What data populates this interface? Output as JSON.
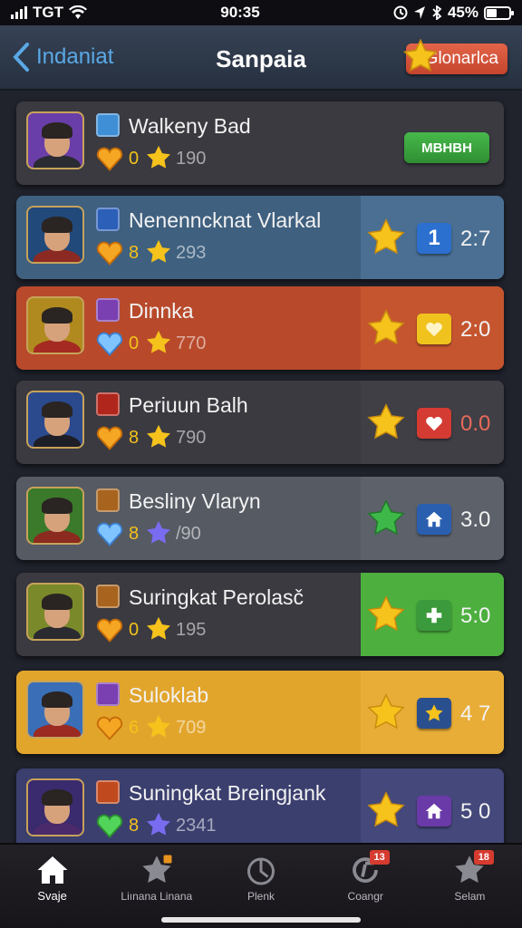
{
  "status_bar": {
    "carrier": "TGT",
    "time": "90:35",
    "battery_level": "45%",
    "battery_fraction": 0.45
  },
  "header": {
    "back_label": "Indaniat",
    "title": "Sanpaia",
    "button_label": "Glonarlca"
  },
  "rows": [
    {
      "name": "Walkeny Bad",
      "stat1": "0",
      "stat2": "190",
      "action_label": "MBHBH",
      "theme": "#3a3a40",
      "accent": "#3a3a40",
      "tag_color": "#3f8fd6",
      "gem": "gold",
      "avatar_bg": "#6a3ea8",
      "body": "#2b2b33"
    },
    {
      "name": "Nenenncknat Vlarkal",
      "stat1": "8",
      "stat2": "293",
      "badge_icon": "number-one-icon",
      "badge_text": "1",
      "badge_color": "#2b6fcf",
      "score": "2:7",
      "theme": "#3f607f",
      "accent": "#4a6f92",
      "tag_color": "#2c5fb8",
      "gem": "gold",
      "avatar_bg": "#21497a",
      "body": "#8b2a22"
    },
    {
      "name": "Dinnka",
      "stat1": "0",
      "stat2": "770",
      "badge_icon": "heart-icon",
      "badge_color": "#f0c21e",
      "score": "2:0",
      "theme": "#b84a2b",
      "accent": "#c5552f",
      "tag_color": "#7a3fb0",
      "gem": "blue",
      "avatar_bg": "#b08a1e",
      "body": "#a42a22"
    },
    {
      "name": "Periuun Balh",
      "stat1": "8",
      "stat2": "790",
      "badge_icon": "heart-icon",
      "badge_color": "#d43b33",
      "score": "0.0",
      "score_color": "#e86a5a",
      "theme": "#3a3a40",
      "accent": "#3f3f45",
      "tag_color": "#b0261c",
      "gem": "gold",
      "avatar_bg": "#2b4a8e",
      "body": "#1e1e26"
    },
    {
      "name": "Besliny Vlaryn",
      "stat1": "8",
      "stat2": "/90",
      "badge_icon": "house-icon",
      "badge_color": "#2a5fb0",
      "score": "3.0",
      "theme": "#555a63",
      "accent": "#5c616a",
      "tag_color": "#a8641e",
      "gem": "blue",
      "avatar_bg": "#3a7a2a",
      "body": "#8b2a1e"
    },
    {
      "name": "Suringkat Perolasč",
      "stat1": "0",
      "stat2": "195",
      "badge_icon": "plus-icon",
      "badge_color": "#3b9a3b",
      "score": "5:0",
      "theme": "#3a3a40",
      "accent": "#4caf3e",
      "tag_color": "#a8641e",
      "gem": "gold",
      "avatar_bg": "#7a8a2a",
      "body": "#2a2a30"
    },
    {
      "name": "Suloklab",
      "stat1": "6",
      "stat2": "709",
      "badge_icon": "star-icon",
      "badge_color": "#2a4f8e",
      "score": "4 7",
      "theme": "#e2a52c",
      "accent": "#e8ad36",
      "tag_color": "#7a3fb0",
      "gem": "gold",
      "avatar_bg": "#3a6fb8",
      "body": "#9a2a22"
    },
    {
      "name": "Suningkat Breingjank",
      "stat1": "8",
      "stat2": "2341",
      "badge_icon": "house-icon",
      "badge_color": "#6a3aa8",
      "score": "5 0",
      "theme": "#3b3f6e",
      "accent": "#44487a",
      "tag_color": "#c04a1e",
      "gem": "green",
      "avatar_bg": "#3a2a6e",
      "body": "#4a2a6a"
    }
  ],
  "bottom_nav": [
    {
      "label": "Svaje",
      "icon": "home-icon",
      "active": true
    },
    {
      "label": "Liınana Linana",
      "icon": "star-badge-icon",
      "badge": ""
    },
    {
      "label": "Plenk",
      "icon": "timer-icon"
    },
    {
      "label": "Coangr",
      "icon": "refresh-icon",
      "badge": "13"
    },
    {
      "label": "Selam",
      "icon": "star-icon",
      "badge": "18"
    }
  ]
}
